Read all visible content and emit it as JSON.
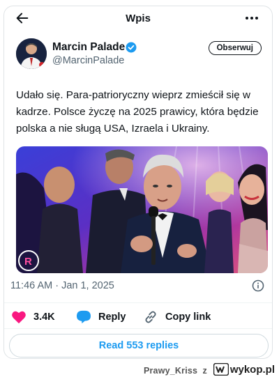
{
  "header": {
    "title": "Wpis",
    "back_icon": "arrow-left-icon",
    "more_icon": "more-dots-icon"
  },
  "author": {
    "display_name": "Marcin Palade",
    "handle": "@MarcinPalade",
    "verified": true,
    "follow_label": "Obserwuj"
  },
  "tweet": {
    "text": "Udało się. Para-patrioryczny wieprz zmieścił się w kadrze. Polsce życzę na 2025 prawicy, która będzie polska a nie sługą USA, Izraela i Ukrainy.",
    "timestamp": "11:46 AM · Jan 1, 2025"
  },
  "actions": {
    "likes_count": "3.4K",
    "reply_label": "Reply",
    "copy_link_label": "Copy link",
    "read_replies_label": "Read 553 replies"
  },
  "colors": {
    "accent": "#1d9bf0",
    "like": "#f91880",
    "text": "#0f1419",
    "muted": "#536471"
  },
  "watermark": {
    "user": "Prawy_Kriss",
    "separator": "z",
    "logo_text": "wykop.pl"
  }
}
